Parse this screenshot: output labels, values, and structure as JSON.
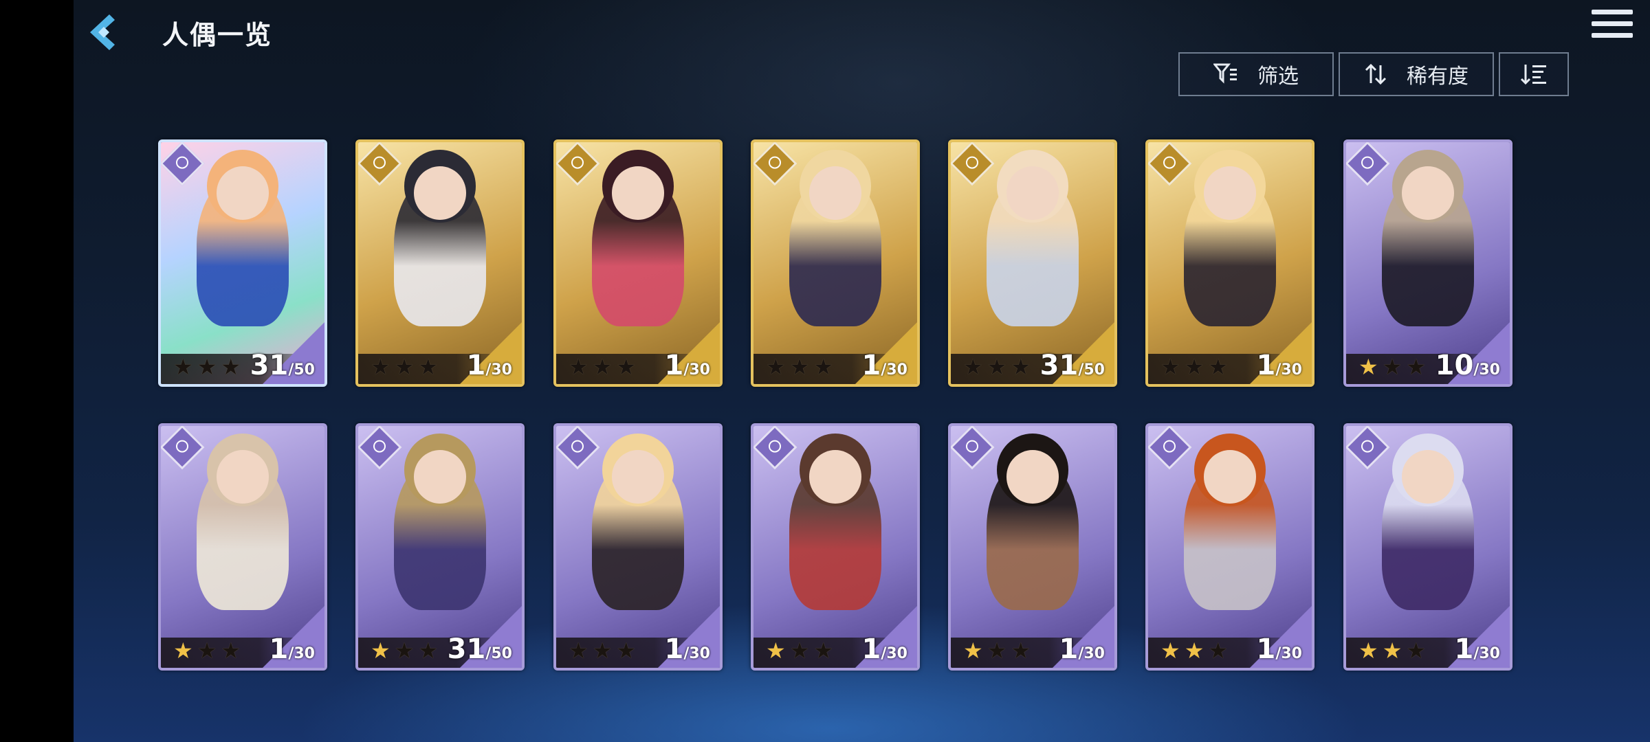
{
  "header": {
    "title": "人偶一览",
    "back_icon": "back-chevron-icon",
    "menu_icon": "hamburger-menu-icon"
  },
  "toolbar": {
    "filter_label": "筛选",
    "sort_label": "稀有度",
    "filter_icon": "filter-icon",
    "sort_icon": "sort-icon",
    "order_icon": "sort-order-icon"
  },
  "cards": [
    {
      "frame": "rainbow",
      "stars": 0,
      "level": "31",
      "max": "/50",
      "art": [
        "#f4b37a",
        "#2a4db5"
      ]
    },
    {
      "frame": "gold",
      "stars": 0,
      "level": "1",
      "max": "/30",
      "art": [
        "#2b2b35",
        "#e8e8ee"
      ]
    },
    {
      "frame": "gold",
      "stars": 0,
      "level": "1",
      "max": "/30",
      "art": [
        "#3a1c24",
        "#d44a6a"
      ]
    },
    {
      "frame": "gold",
      "stars": 0,
      "level": "1",
      "max": "/30",
      "art": [
        "#f0d7a0",
        "#2c2950"
      ]
    },
    {
      "frame": "gold",
      "stars": 0,
      "level": "31",
      "max": "/50",
      "art": [
        "#f2dcc0",
        "#c9d4ea"
      ]
    },
    {
      "frame": "gold",
      "stars": 0,
      "level": "1",
      "max": "/30",
      "art": [
        "#f3d79a",
        "#2a2430"
      ]
    },
    {
      "frame": "purple",
      "stars": 1,
      "level": "10",
      "max": "/30",
      "art": [
        "#b8a58e",
        "#1c1a26"
      ]
    },
    {
      "frame": "purple",
      "stars": 1,
      "level": "1",
      "max": "/30",
      "art": [
        "#d8c3aa",
        "#eee8d8"
      ]
    },
    {
      "frame": "purple",
      "stars": 1,
      "level": "31",
      "max": "/50",
      "art": [
        "#b6995e",
        "#3c3470"
      ]
    },
    {
      "frame": "purple",
      "stars": 0,
      "level": "1",
      "max": "/30",
      "art": [
        "#f2d49a",
        "#2a2226"
      ]
    },
    {
      "frame": "purple",
      "stars": 1,
      "level": "1",
      "max": "/30",
      "art": [
        "#5b3a2e",
        "#b43a36"
      ]
    },
    {
      "frame": "purple",
      "stars": 1,
      "level": "1",
      "max": "/30",
      "art": [
        "#1c1614",
        "#9a6a4a"
      ]
    },
    {
      "frame": "purple",
      "stars": 2,
      "level": "1",
      "max": "/30",
      "art": [
        "#c8561e",
        "#c7c2c8"
      ]
    },
    {
      "frame": "purple",
      "stars": 2,
      "level": "1",
      "max": "/30",
      "art": [
        "#dcdcf0",
        "#3e2a66"
      ]
    }
  ],
  "star_symbol": "★"
}
